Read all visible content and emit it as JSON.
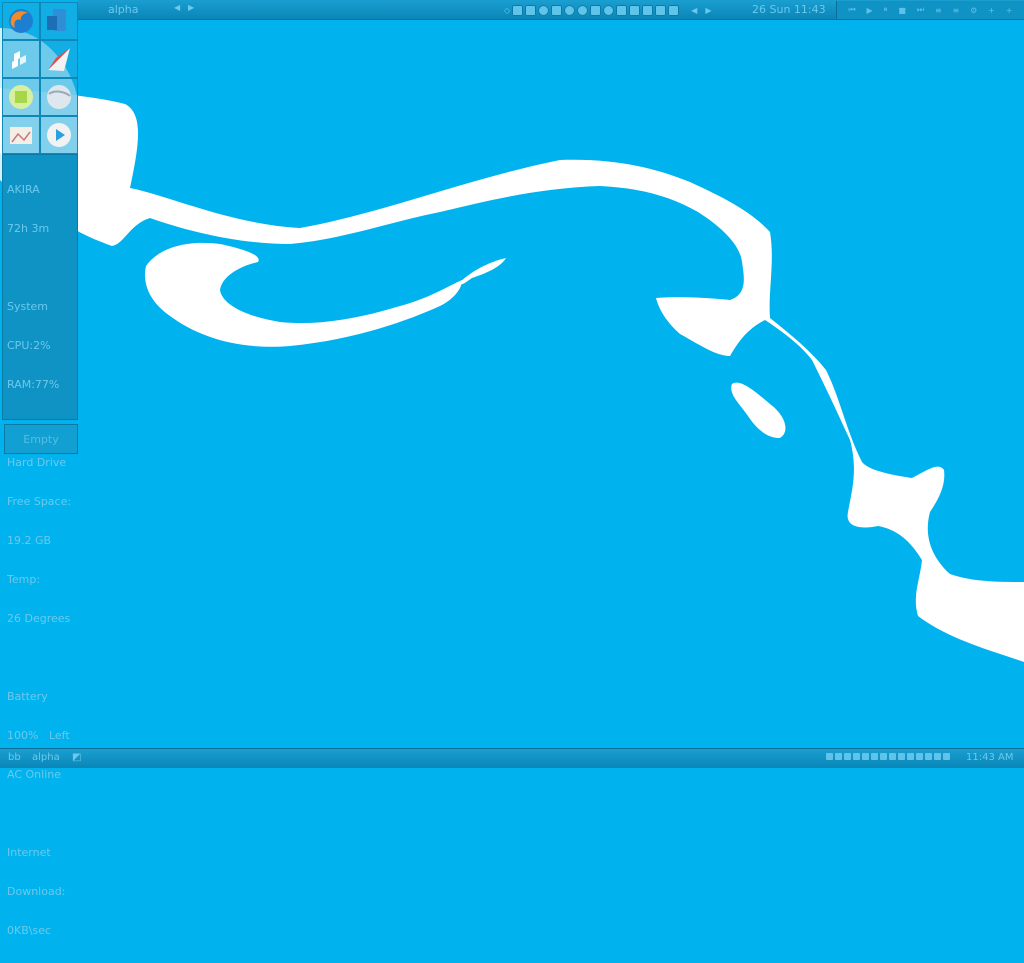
{
  "top_bar": {
    "workspace": "alpha",
    "prev_icon": "arrow-left-icon",
    "next_icon": "arrow-right-icon",
    "tray_icons": [
      "diamond-icon",
      "volume-icon",
      "monitor-icon",
      "search-icon",
      "network-icon",
      "update-icon",
      "grid-icon",
      "shield-icon",
      "refresh-icon",
      "display-icon",
      "wifi-icon",
      "tool-icon",
      "pen-icon",
      "cursor-icon",
      "arrow-left-icon",
      "arrow-right-icon"
    ],
    "clock": "26 Sun 11:43",
    "player_controls": [
      "prev-icon",
      "play-icon",
      "pause-icon",
      "stop-icon",
      "next-icon",
      "playlist-icon",
      "eq-icon",
      "settings-icon",
      "add-icon",
      "plus-icon"
    ]
  },
  "launchers": [
    {
      "name": "firefox-icon"
    },
    {
      "name": "computer-icon"
    },
    {
      "name": "molecule-icon"
    },
    {
      "name": "paper-plane-icon"
    },
    {
      "name": "chip-icon"
    },
    {
      "name": "disc-icon"
    },
    {
      "name": "image-viewer-icon"
    },
    {
      "name": "media-player-icon"
    }
  ],
  "sysmon": {
    "host": "AKIRA",
    "uptime": "72h 3m",
    "system_label": "System",
    "cpu": "CPU:2%",
    "ram": "RAM:77%",
    "hd_label": "Hard Drive",
    "free_label": "Free Space:",
    "free_value": "19.2 GB",
    "temp_label": "Temp:",
    "temp_value": "26 Degrees",
    "battery_label": "Battery",
    "battery_value": "100%   Left",
    "ac": "AC Online",
    "internet_label": "Internet",
    "download_label": "Download:",
    "download_value": "0KB\\sec"
  },
  "empty_button": "Empty",
  "bottom_bar": {
    "item1": "bb",
    "item2": "alpha",
    "clock": "11:43 AM"
  },
  "colors": {
    "background": "#00b3ee",
    "panel": "#0f93c4",
    "text": "#6cc8ec"
  }
}
